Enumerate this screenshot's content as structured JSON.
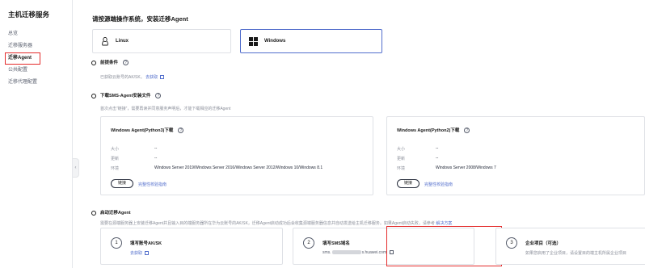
{
  "sidebar": {
    "title": "主机迁移服务",
    "items": [
      {
        "label": "总览"
      },
      {
        "label": "迁移服务器"
      },
      {
        "label": "迁移Agent"
      },
      {
        "label": "公共配置"
      },
      {
        "label": "迁移代理配置"
      }
    ],
    "active_index": 2
  },
  "main": {
    "heading": "请按源端操作系统，安装迁移Agent",
    "os_options": [
      {
        "label": "Linux",
        "icon": "linux-penguin-icon",
        "selected": false
      },
      {
        "label": "Windows",
        "icon": "windows-logo-icon",
        "selected": true
      }
    ],
    "prereq": {
      "title": "前提条件",
      "desc": "已获取云账号的AK/SK。",
      "link": "去获取"
    },
    "download": {
      "title": "下载SMS-Agent安装文件",
      "desc": "首次点击“链接”，需要再读并同意服务声明后，才能下载相应的迁移Agent",
      "panels": [
        {
          "title": "Windows Agent(Python3)下载",
          "size_label": "大小",
          "size_value": "--",
          "update_label": "更新",
          "update_value": "--",
          "env_label": "环境",
          "env_value": "Windows Server 2019/Windows Server 2016/Windows Server 2012/Windows 10/Windows 8.1",
          "button": "链接",
          "verify": "完整性校验指南"
        },
        {
          "title": "Windows Agent(Python2)下载",
          "size_label": "大小",
          "size_value": "--",
          "update_label": "更新",
          "update_value": "--",
          "env_label": "环境",
          "env_value": "Windows Server 2008/Windows 7",
          "button": "链接",
          "verify": "完整性校验指南"
        }
      ]
    },
    "start": {
      "title": "启动迁移Agent",
      "desc": "需要在源端服务器上安装迁移Agent并且输入目的端服务器所在华为云账号的AK/SK，迁移Agent启动成功后会收集源端服务器信息并自动发送给主机迁移服务。如果Agent启动失败，请参考",
      "link": "解决方案",
      "cards": [
        {
          "num": "1",
          "title": "填写账号AK/SK",
          "sub": "去获取"
        },
        {
          "num": "2",
          "title": "填写SMS域名",
          "sub_prefix": "sms.",
          "sub_suffix": "s.huawei.com"
        },
        {
          "num": "3",
          "title": "企业项目（可选）",
          "sub": "如果您启用了企业项目，请设置目的端主机所属企业项目"
        }
      ]
    }
  },
  "colors": {
    "accent": "#526ecc",
    "highlight": "#e42b2b"
  }
}
